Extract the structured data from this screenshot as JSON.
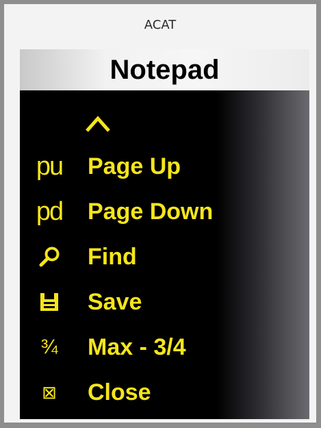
{
  "window": {
    "title": "ACAT"
  },
  "panel": {
    "header": "Notepad",
    "scroll_up_icon": "chevron-up-icon",
    "items": [
      {
        "icon": "page-up-icon",
        "icon_text": "pu",
        "label": "Page Up"
      },
      {
        "icon": "page-down-icon",
        "icon_text": "pd",
        "label": "Page Down"
      },
      {
        "icon": "magnifier-icon",
        "label": "Find"
      },
      {
        "icon": "floppy-disk-icon",
        "label": "Save"
      },
      {
        "icon": "three-quarters-icon",
        "icon_text": "¾",
        "label": "Max - 3/4"
      },
      {
        "icon": "close-box-icon",
        "icon_text": "⊠",
        "label": "Close"
      }
    ]
  },
  "colors": {
    "menu_text": "#f5e51b",
    "menu_background": "#000000",
    "window_border": "#8e8e8e"
  }
}
